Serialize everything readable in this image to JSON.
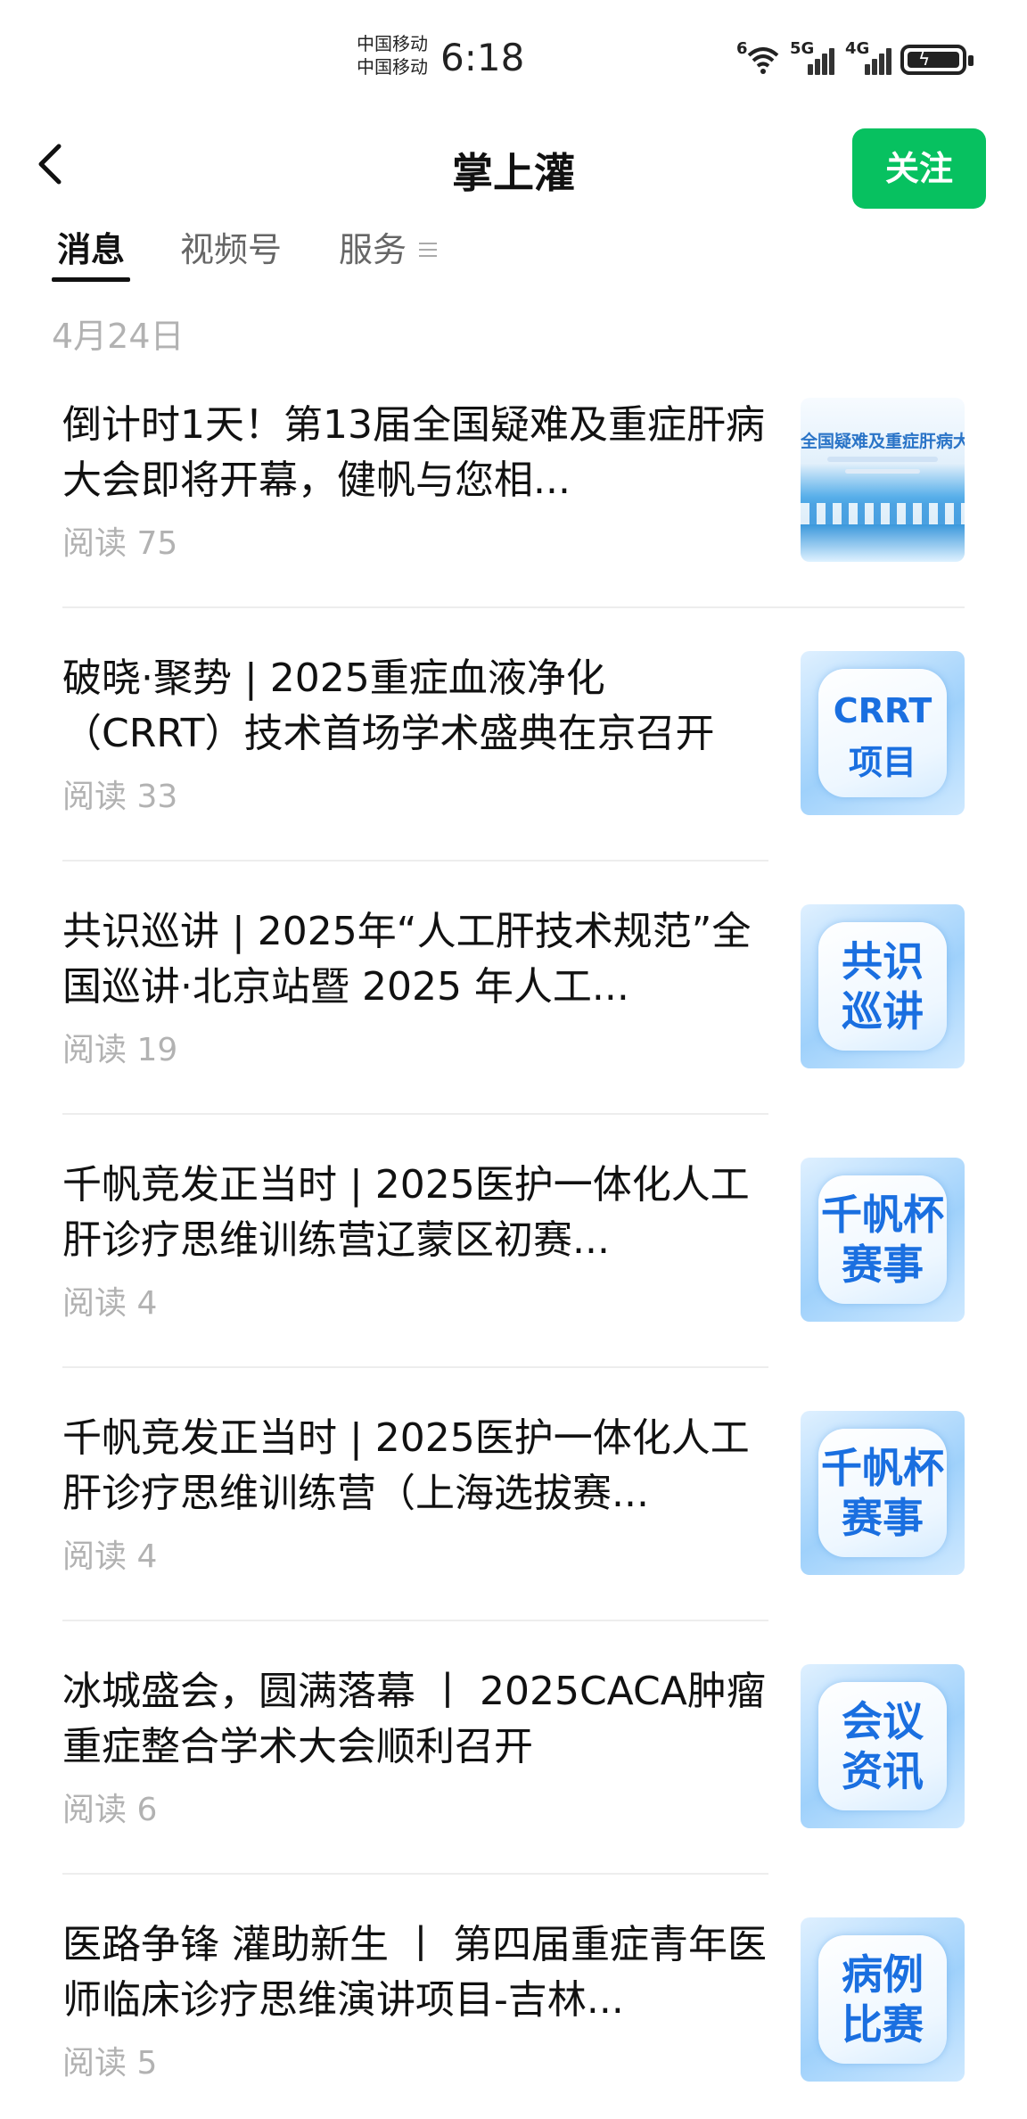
{
  "status_bar": {
    "carrier_1": "中国移动",
    "carrier_2": "中国移动",
    "time": "6:18",
    "wifi_tag": "6",
    "sim1_tag": "5G",
    "sim2_tag": "4G"
  },
  "nav": {
    "title": "掌上灌",
    "follow_label": "关注"
  },
  "tabs": [
    {
      "label": "消息"
    },
    {
      "label": "视频号"
    },
    {
      "label": "服务"
    }
  ],
  "feed": {
    "date": "4月24日",
    "articles": [
      {
        "title": "倒计时1天！第13届全国疑难及重症肝病大会即将开幕，健帆与您相...",
        "reads": "阅读 75",
        "thumb": "全国疑难及重症肝病大会"
      },
      {
        "title": "破晓·聚势 | 2025重症血液净化（CRRT）技术首场学术盛典在京召开",
        "reads": "阅读 33",
        "thumb": "CRRT\n项目"
      },
      {
        "title": "共识巡讲 | 2025年“人工肝技术规范”全国巡讲·北京站暨 2025 年人工...",
        "reads": "阅读 19",
        "thumb": "共识\n巡讲"
      },
      {
        "title": "千帆竞发正当时 | 2025医护一体化人工肝诊疗思维训练营辽蒙区初赛...",
        "reads": "阅读 4",
        "thumb": "千帆杯\n赛事"
      },
      {
        "title": "千帆竞发正当时 | 2025医护一体化人工肝诊疗思维训练营（上海选拔赛...",
        "reads": "阅读 4",
        "thumb": "千帆杯\n赛事"
      },
      {
        "title": "冰城盛会，圆满落幕 丨 2025CACA肿瘤重症整合学术大会顺利召开",
        "reads": "阅读 6",
        "thumb": "会议\n资讯"
      },
      {
        "title": "医路争锋 灌助新生 丨 第四届重症青年医师临床诊疗思维演讲项目-吉林...",
        "reads": "阅读 5",
        "thumb": "病例\n比赛"
      }
    ]
  },
  "colors": {
    "follow_button": "#07c160",
    "thumb_text": "#1a6fe0",
    "muted_text": "#b2b2b2"
  }
}
